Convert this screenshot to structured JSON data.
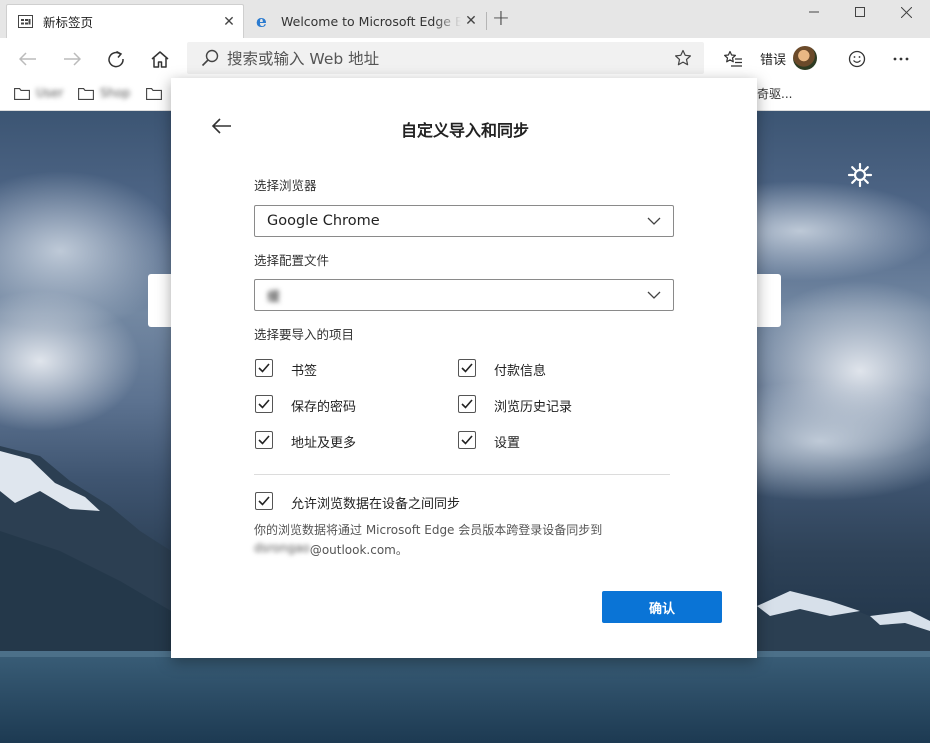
{
  "browser": {
    "tabs": [
      {
        "title": "新标签页"
      },
      {
        "title": "Welcome to Microsoft Edge Beta"
      }
    ],
    "new_tab_glyph": "+",
    "window_controls": [
      "minimize-icon",
      "maximize-icon",
      "close-icon"
    ]
  },
  "toolbar": {
    "address_placeholder": "搜索或输入 Web 地址",
    "profile_label": "错误"
  },
  "favorites": [
    {
      "label": "User",
      "icon": "folder-icon"
    },
    {
      "label": "Shop",
      "icon": "folder-icon"
    },
    {
      "label": "",
      "icon": "folder-icon"
    }
  ],
  "favorites_overflow": "奇驱...",
  "dialog": {
    "title": "自定义导入和同步",
    "browser_label": "选择浏览器",
    "browser_value": "Google Chrome",
    "profile_label": "选择配置文件",
    "profile_value": "缓",
    "items_label": "选择要导入的项目",
    "items": [
      {
        "label": "书签",
        "checked": true
      },
      {
        "label": "付款信息",
        "checked": true
      },
      {
        "label": "保存的密码",
        "checked": true
      },
      {
        "label": "浏览历史记录",
        "checked": true
      },
      {
        "label": "地址及更多",
        "checked": true
      },
      {
        "label": "设置",
        "checked": true
      }
    ],
    "sync_label": "允许浏览数据在设备之间同步",
    "sync_checked": true,
    "sync_note": "你的浏览数据将通过 Microsoft Edge 会员版本跨登录设备同步到",
    "sync_account_blurred": "dsrongao",
    "sync_account_domain": "@outlook.com。",
    "confirm_label": "确认"
  },
  "colors": {
    "accent": "#0a74d6",
    "tab_strip": "#e6e6e6",
    "address_bg": "#f1f1f1"
  }
}
